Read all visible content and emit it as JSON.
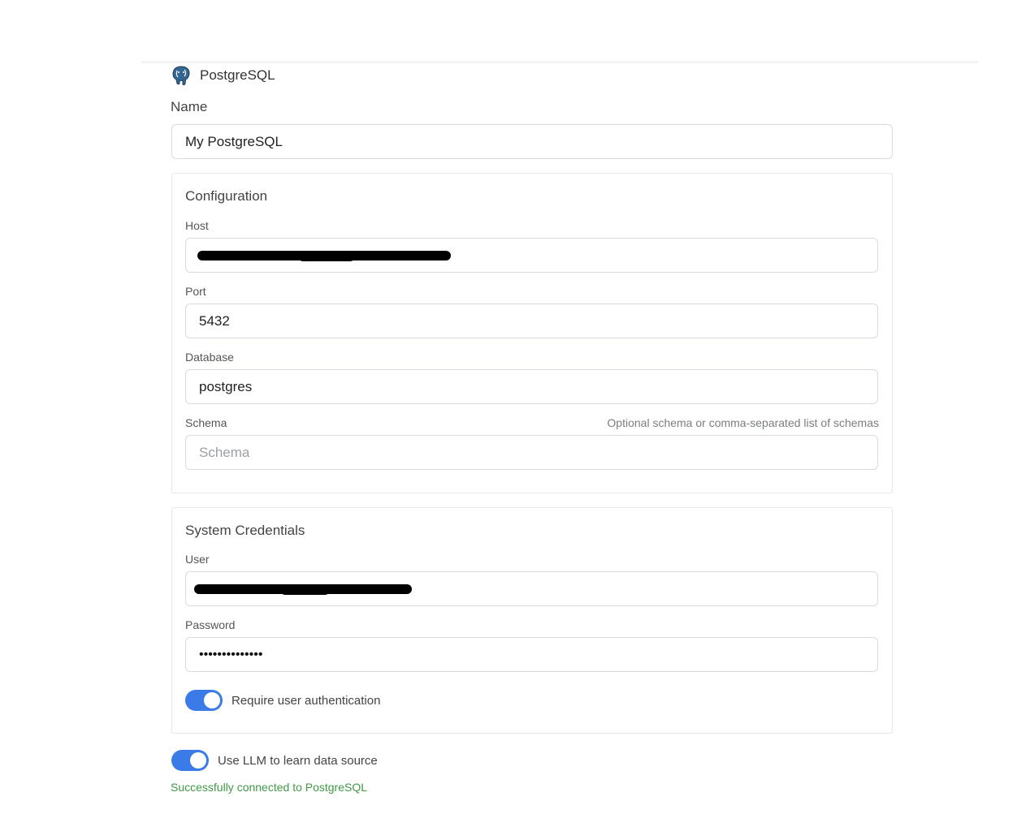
{
  "header": {
    "title": "PostgreSQL",
    "logo_icon": "postgresql-elephant-icon"
  },
  "name_field": {
    "label": "Name",
    "value": "My PostgreSQL"
  },
  "configuration": {
    "title": "Configuration",
    "host": {
      "label": "Host",
      "value_redacted": true
    },
    "port": {
      "label": "Port",
      "value": "5432"
    },
    "database": {
      "label": "Database",
      "value": "postgres"
    },
    "schema": {
      "label": "Schema",
      "hint": "Optional schema or comma-separated list of schemas",
      "placeholder": "Schema",
      "value": ""
    }
  },
  "credentials": {
    "title": "System Credentials",
    "user": {
      "label": "User",
      "value_redacted": true
    },
    "password": {
      "label": "Password",
      "masked_value": "••••••••••••••"
    },
    "require_auth": {
      "label": "Require user authentication",
      "enabled": true
    }
  },
  "llm_toggle": {
    "label": "Use LLM to learn data source",
    "enabled": true
  },
  "status": {
    "message": "Successfully connected to PostgreSQL",
    "color": "#3f9a45"
  },
  "colors": {
    "accent": "#3a7be8",
    "border": "#d8dbe0"
  }
}
